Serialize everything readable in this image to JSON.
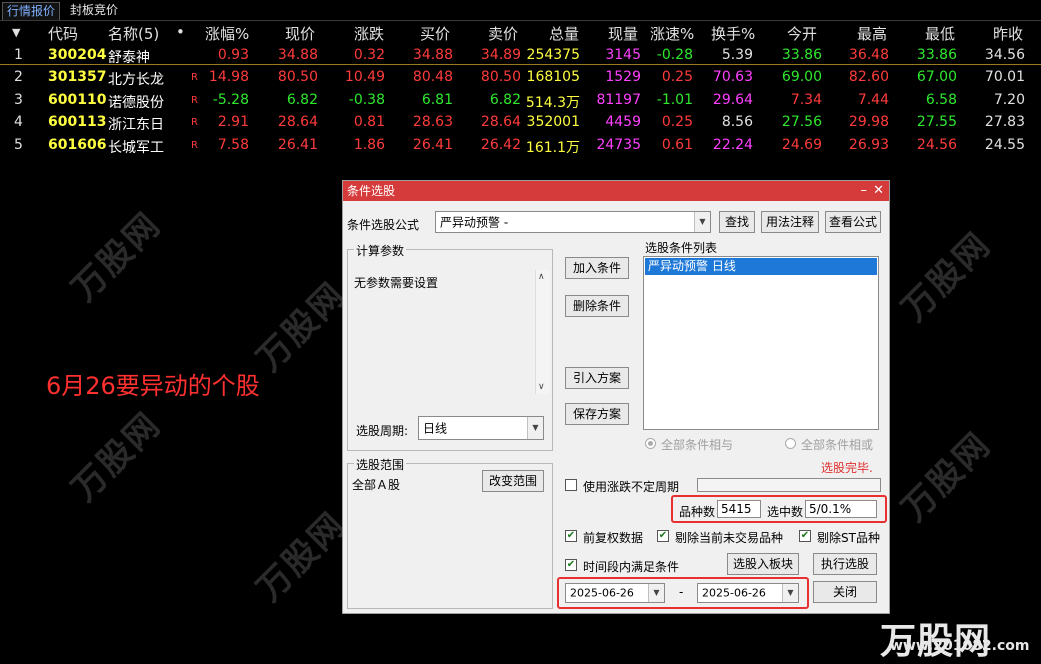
{
  "tabs": [
    "行情报价",
    "封板竞价"
  ],
  "table": {
    "headers": [
      "代码",
      "名称(5)",
      "•",
      "涨幅%",
      "现价",
      "涨跌",
      "买价",
      "卖价",
      "总量",
      "现量",
      "涨速%",
      "换手%",
      "今开",
      "最高",
      "最低",
      "昨收"
    ],
    "rows": [
      {
        "idx": "1",
        "code": "300204",
        "name": "舒泰神",
        "r": "",
        "chg_pct": "0.93",
        "price": "34.88",
        "chg": "0.32",
        "bid": "34.88",
        "ask": "34.89",
        "vol": "254375",
        "cur_vol": "3145",
        "speed": "-0.28",
        "turnover": "5.39",
        "open": "33.86",
        "high": "36.48",
        "low": "33.86",
        "prev": "34.56"
      },
      {
        "idx": "2",
        "code": "301357",
        "name": "北方长龙",
        "r": "R",
        "chg_pct": "14.98",
        "price": "80.50",
        "chg": "10.49",
        "bid": "80.48",
        "ask": "80.50",
        "vol": "168105",
        "cur_vol": "1529",
        "speed": "0.25",
        "turnover": "70.63",
        "open": "69.00",
        "high": "82.60",
        "low": "67.00",
        "prev": "70.01"
      },
      {
        "idx": "3",
        "code": "600110",
        "name": "诺德股份",
        "r": "R",
        "chg_pct": "-5.28",
        "price": "6.82",
        "chg": "-0.38",
        "bid": "6.81",
        "ask": "6.82",
        "vol": "514.3万",
        "cur_vol": "81197",
        "speed": "-1.01",
        "turnover": "29.64",
        "open": "7.34",
        "high": "7.44",
        "low": "6.58",
        "prev": "7.20"
      },
      {
        "idx": "4",
        "code": "600113",
        "name": "浙江东日",
        "r": "R",
        "chg_pct": "2.91",
        "price": "28.64",
        "chg": "0.81",
        "bid": "28.63",
        "ask": "28.64",
        "vol": "352001",
        "cur_vol": "4459",
        "speed": "0.25",
        "turnover": "8.56",
        "open": "27.56",
        "high": "29.98",
        "low": "27.55",
        "prev": "27.83"
      },
      {
        "idx": "5",
        "code": "601606",
        "name": "长城军工",
        "r": "R",
        "chg_pct": "7.58",
        "price": "26.41",
        "chg": "1.86",
        "bid": "26.41",
        "ask": "26.42",
        "vol": "161.1万",
        "cur_vol": "24735",
        "speed": "0.61",
        "turnover": "22.24",
        "open": "24.69",
        "high": "26.93",
        "low": "24.56",
        "prev": "24.55"
      }
    ]
  },
  "annotation": "6月26要异动的个股",
  "dialog": {
    "title": "条件选股",
    "formula_label": "条件选股公式",
    "formula_value": "严异动预警  -",
    "btn_find": "查找",
    "btn_usage": "用法注释",
    "btn_view": "查看公式",
    "params_group": "计算参数",
    "params_text": "无参数需要设置",
    "period_label": "选股周期:",
    "period_value": "日线",
    "scope_group": "选股范围",
    "scope_value": "全部Ａ股",
    "btn_change_scope": "改变范围",
    "btn_add": "加入条件",
    "btn_delete": "删除条件",
    "btn_import": "引入方案",
    "btn_save": "保存方案",
    "list_title": "选股条件列表",
    "list_items": [
      "严异动预警  日线"
    ],
    "radio_and": "全部条件相与",
    "radio_or": "全部条件相或",
    "status": "选股完毕.",
    "chk_unfixed": "使用涨跌不定周期",
    "count_label": "品种数",
    "count_value": "5415",
    "selected_label": "选中数",
    "selected_value": "5/0.1%",
    "chk_fq": "前复权数据",
    "chk_untraded": "剔除当前未交易品种",
    "chk_st": "剔除ST品种",
    "chk_period": "时间段内满足条件",
    "btn_to_block": "选股入板块",
    "btn_execute": "执行选股",
    "date_from": "2025-06-26",
    "date_sep": "-",
    "date_to": "2025-06-26",
    "btn_close": "关闭"
  },
  "watermark": "万股网",
  "logo": {
    "text": "万股网",
    "url": "www.201082.com"
  }
}
